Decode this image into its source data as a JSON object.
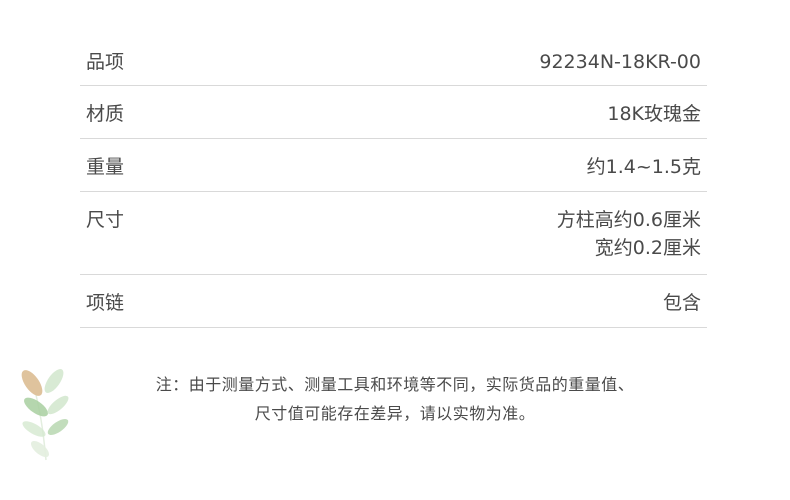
{
  "specs": [
    {
      "label": "品项",
      "values": [
        "92234N-18KR-00"
      ]
    },
    {
      "label": "材质",
      "values": [
        "18K玫瑰金"
      ]
    },
    {
      "label": "重量",
      "values": [
        "约1.4~1.5克"
      ]
    },
    {
      "label": "尺寸",
      "values": [
        "方柱高约0.6厘米",
        "宽约0.2厘米"
      ]
    },
    {
      "label": "项链",
      "values": [
        "包含"
      ]
    }
  ],
  "note": {
    "line1": "注：由于测量方式、测量工具和环境等不同，实际货品的重量值、",
    "line2": "尺寸值可能存在差异，请以实物为准。"
  },
  "colors": {
    "text": "#4a4a4a",
    "divider": "#d9d9d9",
    "leaf_tan": "#d9b98c",
    "leaf_green": "#a8cfa0",
    "leaf_light": "#d4e8cf"
  }
}
